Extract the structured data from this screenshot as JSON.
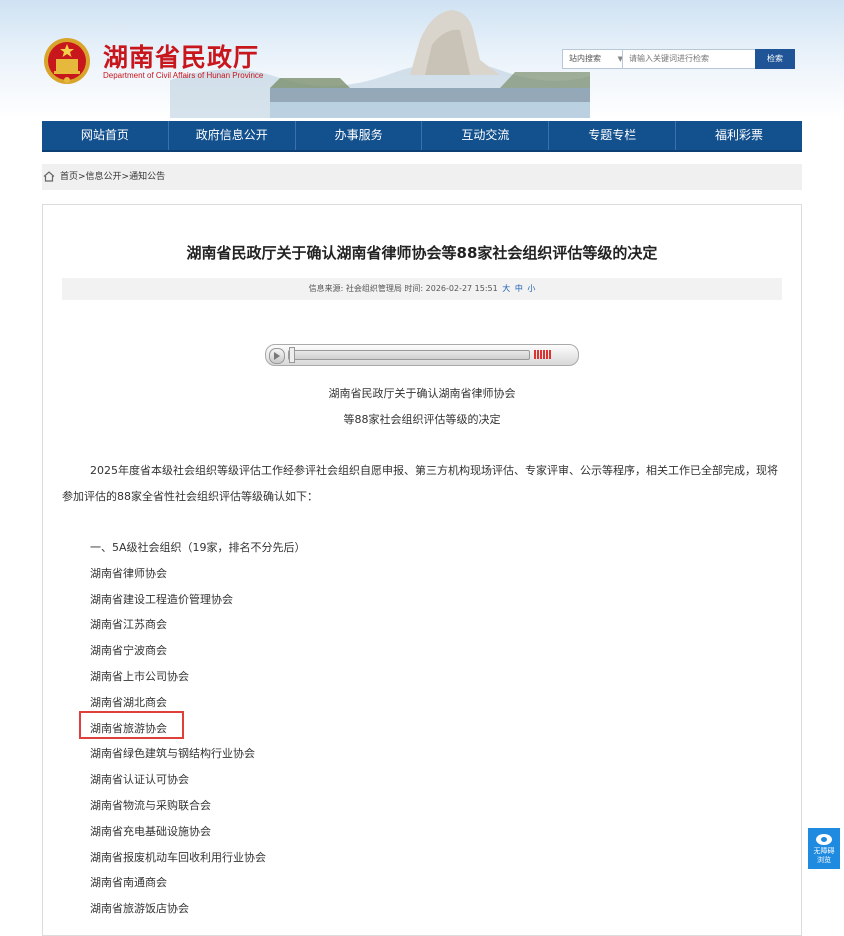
{
  "header": {
    "title": "湖南省民政厅",
    "subtitle": "Department of Civil Affairs of Hunan Province"
  },
  "search": {
    "scope": "站内搜索",
    "placeholder": "请输入关键词进行检索",
    "button": "检索"
  },
  "nav": {
    "items": [
      "网站首页",
      "政府信息公开",
      "办事服务",
      "互动交流",
      "专题专栏",
      "福利彩票"
    ]
  },
  "breadcrumb": "首页>信息公开>通知公告",
  "article": {
    "title": "湖南省民政厅关于确认湖南省律师协会等88家社会组织评估等级的决定",
    "meta": "信息来源: 社会组织管理局  时间: 2026-02-27 15:51",
    "font_large": "大",
    "font_medium": "中",
    "font_small": "小",
    "subtitle_line1": "湖南省民政厅关于确认湖南省律师协会",
    "subtitle_line2": "等88家社会组织评估等级的决定",
    "paragraph": "2025年度省本级社会组织等级评估工作经参评社会组织自愿申报、第三方机构现场评估、专家评审、公示等程序，相关工作已全部完成，现将参加评估的88家全省性社会组织评估等级确认如下：",
    "section_heading": "一、5A级社会组织（19家，排名不分先后）",
    "orgs": [
      "湖南省律师协会",
      "湖南省建设工程造价管理协会",
      "湖南省江苏商会",
      "湖南省宁波商会",
      "湖南省上市公司协会",
      "湖南省湖北商会",
      "湖南省旅游协会",
      "湖南省绿色建筑与钢结构行业协会",
      "湖南省认证认可协会",
      "湖南省物流与采购联合会",
      "湖南省充电基础设施协会",
      "湖南省报废机动车回收利用行业协会",
      "湖南省南通商会",
      "湖南省旅游饭店协会"
    ]
  },
  "accessibility": {
    "label_line1": "无障碍",
    "label_line2": "浏览"
  },
  "colors": {
    "brand_red": "#c8161d",
    "nav_blue": "#13508e",
    "link_blue": "#1b5fb1",
    "highlight_red": "#e0403a"
  }
}
